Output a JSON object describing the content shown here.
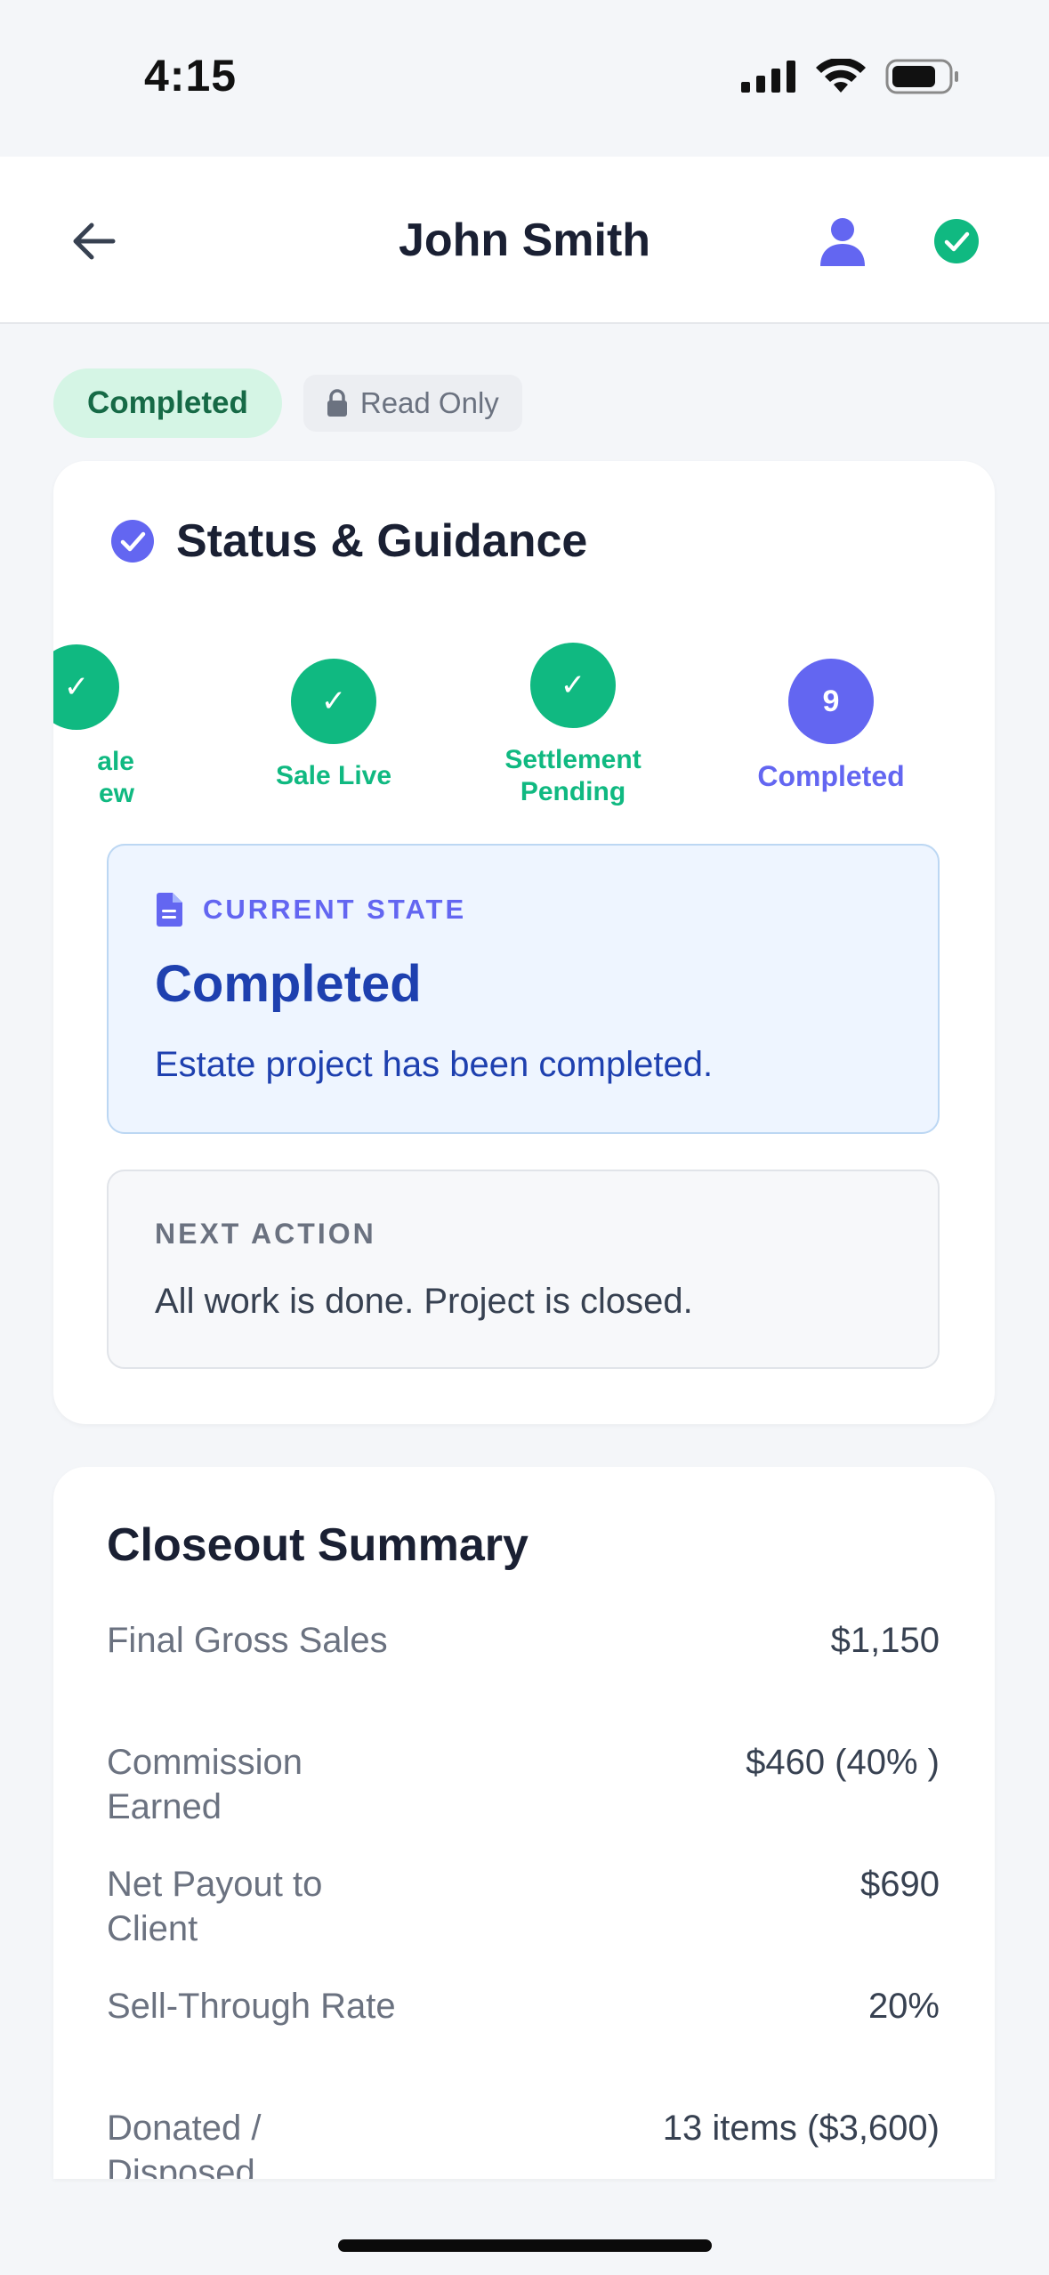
{
  "status_bar": {
    "time": "4:15"
  },
  "header": {
    "title": "John Smith",
    "back_icon": "arrow-left-icon",
    "user_icon": "user-icon",
    "done_icon": "check-circle-icon"
  },
  "badges": {
    "completed": "Completed",
    "read_only": "Read Only"
  },
  "status_card": {
    "title": "Status & Guidance",
    "steps": [
      {
        "label": "Sale\nReview",
        "visible_label": "ale\new",
        "state": "done"
      },
      {
        "label": "Sale Live",
        "state": "done"
      },
      {
        "label": "Settlement\nPending",
        "state": "done"
      },
      {
        "label": "Completed",
        "number": "9",
        "state": "current"
      }
    ],
    "current_state": {
      "label": "CURRENT STATE",
      "title": "Completed",
      "description": "Estate project has been completed."
    },
    "next_action": {
      "label": "NEXT ACTION",
      "text": "All work is done. Project is closed."
    }
  },
  "closeout": {
    "title": "Closeout Summary",
    "rows": [
      {
        "label": "Final Gross Sales",
        "value": "$1,150"
      },
      {
        "label": "Commission Earned",
        "value": "$460 (40% )"
      },
      {
        "label": "Net Payout to Client",
        "value": "$690"
      },
      {
        "label": "Sell-Through Rate",
        "value": "20%"
      },
      {
        "label": "Donated / Disposed",
        "value": "13 items ($3,600)"
      }
    ]
  },
  "colors": {
    "primary": "#6366f1",
    "success": "#10b981",
    "current_state_text": "#1e40af"
  }
}
